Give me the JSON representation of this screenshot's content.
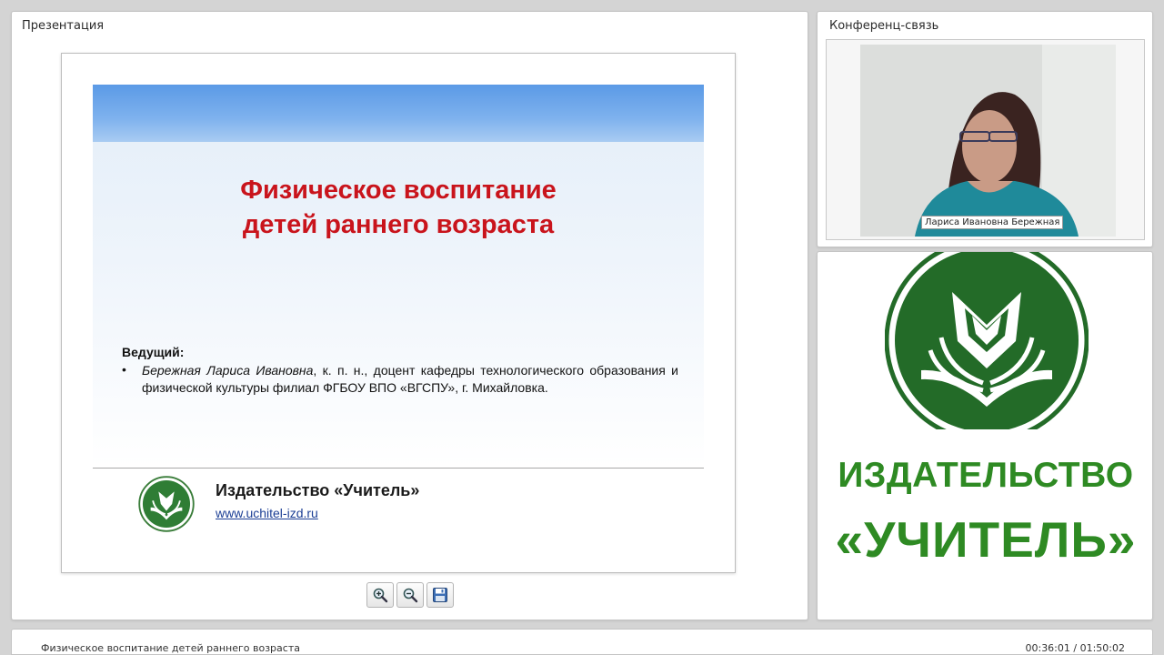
{
  "presentation": {
    "panel_title": "Презентация",
    "slide": {
      "title_line1": "Физическое воспитание",
      "title_line2": "детей раннего возраста",
      "host_heading": "Ведущий:",
      "host_bullet": "•",
      "host_name": "Бережная Лариса Ивановна",
      "host_details": ", к. п. н., доцент кафедры технологического образования и физической культуры филиал ФГБОУ ВПО «ВГСПУ», г. Михайловка.",
      "publisher_name": "Издательство «Учитель»",
      "publisher_url": "www.uchitel-izd.ru",
      "title_color": "#c9141c"
    },
    "toolbar": [
      {
        "name": "zoom-in-button",
        "icon": "zoom-in-icon"
      },
      {
        "name": "zoom-out-button",
        "icon": "zoom-out-icon"
      },
      {
        "name": "save-button",
        "icon": "floppy-disk-icon"
      }
    ]
  },
  "conference": {
    "panel_title": "Конференц-связь",
    "speaker_name": "Лариса Ивановна Бережная"
  },
  "logo_panel": {
    "word1": "ИЗДАТЕЛЬСТВО",
    "word2": "«УЧИТЕЛЬ»",
    "brand_color": "#2e8a23",
    "logo_color": "#236b28"
  },
  "status_bar": {
    "title": "Физическое воспитание детей раннего возраста",
    "time": "00:36:01 / 01:50:02"
  }
}
